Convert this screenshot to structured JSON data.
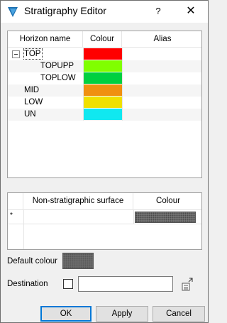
{
  "window": {
    "title": "Stratigraphy Editor",
    "help": "?",
    "close": "✕"
  },
  "horizons": {
    "columns": {
      "name": "Horizon name",
      "colour": "Colour",
      "alias": "Alias"
    },
    "rows": [
      {
        "name": "TOP",
        "colour": "#ff0000",
        "indent": 0,
        "expandable": true
      },
      {
        "name": "TOPUPP",
        "colour": "#80ff00",
        "indent": 2,
        "expandable": false
      },
      {
        "name": "TOPLOW",
        "colour": "#00d040",
        "indent": 2,
        "expandable": false
      },
      {
        "name": "MID",
        "colour": "#f09010",
        "indent": 0,
        "expandable": false
      },
      {
        "name": "LOW",
        "colour": "#f0e000",
        "indent": 0,
        "expandable": false
      },
      {
        "name": "UN",
        "colour": "#10e8f0",
        "indent": 0,
        "expandable": false
      }
    ]
  },
  "nonstrat": {
    "columns": {
      "surface": "Non-stratigraphic surface",
      "colour": "Colour"
    },
    "new_row_marker": "*"
  },
  "default_colour": {
    "label": "Default colour"
  },
  "destination": {
    "label": "Destination",
    "value": "",
    "checked": false
  },
  "buttons": {
    "ok": "OK",
    "apply": "Apply",
    "cancel": "Cancel"
  }
}
